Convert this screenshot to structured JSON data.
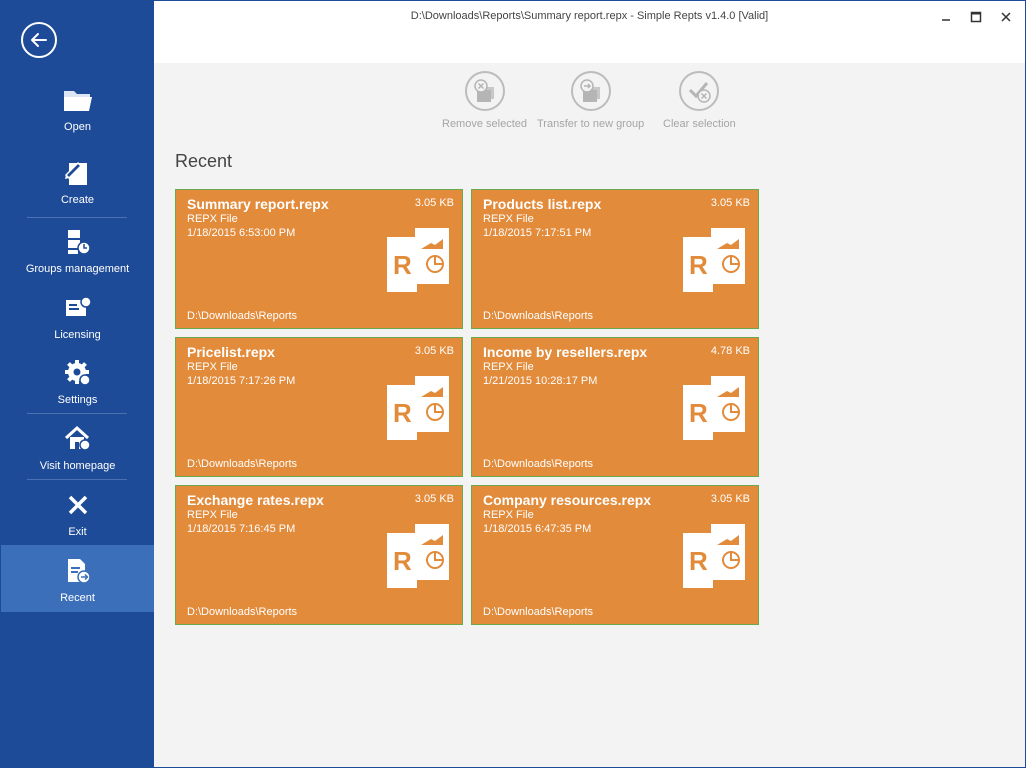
{
  "window": {
    "title": "D:\\Downloads\\Reports\\Summary report.repx - Simple Repts v1.4.0 [Valid]"
  },
  "sidebar": {
    "items": [
      {
        "label": "Open",
        "icon": "folder-icon"
      },
      {
        "label": "Create",
        "icon": "create-icon"
      },
      {
        "label": "Groups management",
        "icon": "groups-icon"
      },
      {
        "label": "Licensing",
        "icon": "licensing-icon"
      },
      {
        "label": "Settings",
        "icon": "settings-icon"
      },
      {
        "label": "Visit homepage",
        "icon": "home-icon"
      },
      {
        "label": "Exit",
        "icon": "close-icon"
      },
      {
        "label": "Recent",
        "icon": "recent-icon"
      }
    ],
    "active": "Recent"
  },
  "toolbar": {
    "remove_label": "Remove selected",
    "transfer_label": "Transfer to new group",
    "clear_label": "Clear selection"
  },
  "main": {
    "section_title": "Recent",
    "files": [
      {
        "name": "Summary report.repx",
        "type": "REPX File",
        "date": "1/18/2015 6:53:00 PM",
        "size": "3.05 KB",
        "path": "D:\\Downloads\\Reports"
      },
      {
        "name": "Products list.repx",
        "type": "REPX File",
        "date": "1/18/2015 7:17:51 PM",
        "size": "3.05 KB",
        "path": "D:\\Downloads\\Reports"
      },
      {
        "name": "Pricelist.repx",
        "type": "REPX File",
        "date": "1/18/2015 7:17:26 PM",
        "size": "3.05 KB",
        "path": "D:\\Downloads\\Reports"
      },
      {
        "name": "Income by resellers.repx",
        "type": "REPX File",
        "date": "1/21/2015 10:28:17 PM",
        "size": "4.78 KB",
        "path": "D:\\Downloads\\Reports"
      },
      {
        "name": "Exchange rates.repx",
        "type": "REPX File",
        "date": "1/18/2015 7:16:45 PM",
        "size": "3.05 KB",
        "path": "D:\\Downloads\\Reports"
      },
      {
        "name": "Company resources.repx",
        "type": "REPX File",
        "date": "1/18/2015 6:47:35 PM",
        "size": "3.05 KB",
        "path": "D:\\Downloads\\Reports"
      }
    ]
  },
  "colors": {
    "sidebar": "#1e4b97",
    "sidebar_active": "#3b6fba",
    "tile": "#e28b3b",
    "tile_border": "#6aaa4c"
  }
}
